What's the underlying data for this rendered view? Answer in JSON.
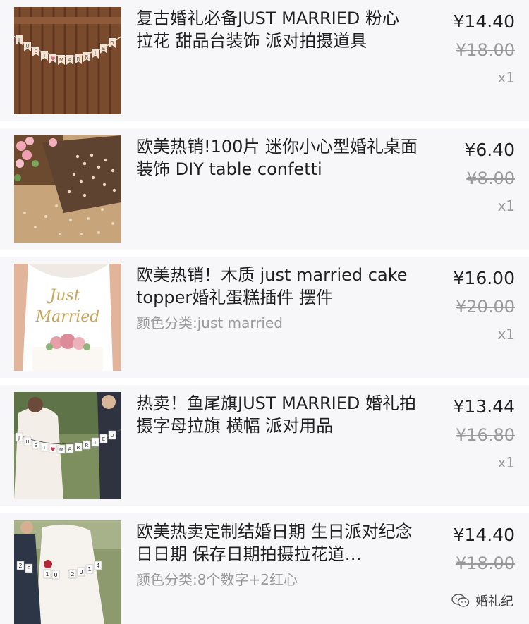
{
  "items": [
    {
      "title": "复古婚礼必备JUST MARRIED 粉心 拉花 甜品台装饰 派对拍摄道具",
      "variant": "",
      "price": "¥14.40",
      "original_price": "¥18.00",
      "quantity": "x1",
      "image_text": [
        "J",
        "U",
        "S",
        "T",
        "♥",
        "M",
        "A",
        "R",
        "R",
        "I",
        "E",
        "D"
      ]
    },
    {
      "title": "欧美热销!100片 迷你小心型婚礼桌面装饰 DIY  table confetti",
      "variant": "",
      "price": "¥6.40",
      "original_price": "¥8.00",
      "quantity": "x1",
      "image_text": []
    },
    {
      "title": "欧美热销！木质 just married cake topper婚礼蛋糕插件 摆件",
      "variant": "颜色分类:just married",
      "price": "¥16.00",
      "original_price": "¥20.00",
      "quantity": "x1",
      "image_text": [
        "Just",
        "Married"
      ]
    },
    {
      "title": "热卖！鱼尾旗JUST MARRIED 婚礼拍摄字母拉旗 横幅 派对用品",
      "variant": "",
      "price": "¥13.44",
      "original_price": "¥16.80",
      "quantity": "x1",
      "image_text": [
        "J",
        "U",
        "S",
        "T",
        "♥",
        "M",
        "A",
        "R",
        "R",
        "I",
        "E",
        "D"
      ]
    },
    {
      "title": "欧美热卖定制结婚日期 生日派对纪念日日期 保存日期拍摄拉花道…",
      "variant": "颜色分类:8个数字+2红心",
      "price": "¥14.40",
      "original_price": "¥18.00",
      "quantity": "",
      "image_text": [
        "2",
        "8",
        "1",
        "0",
        "2",
        "0",
        "1",
        "4"
      ]
    }
  ],
  "watermark": {
    "text": "婚礼纪",
    "icon": "wechat-icon"
  }
}
